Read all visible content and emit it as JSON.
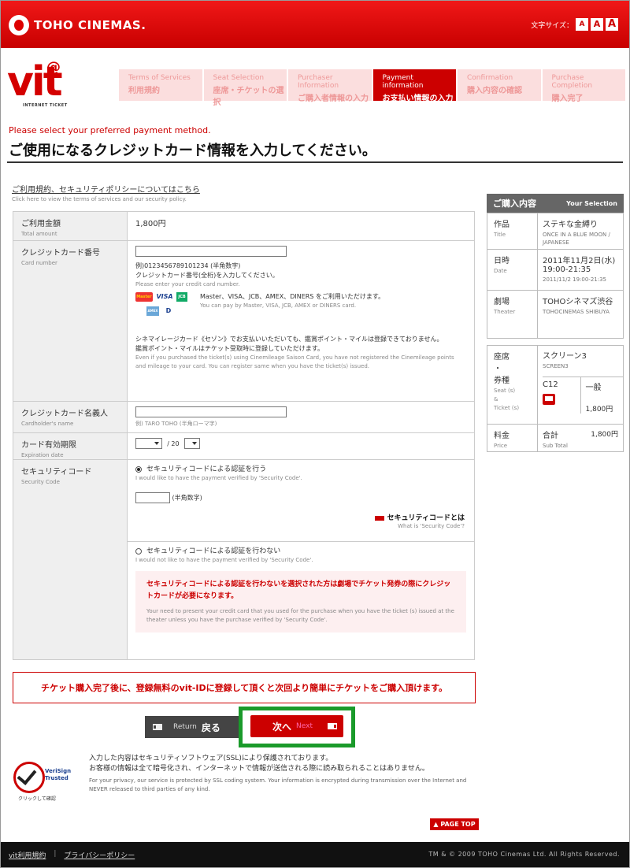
{
  "header": {
    "brand": "TOHO CINEMAS.",
    "font_size_label": "文字サイズ：",
    "font_sizes": [
      "A",
      "A",
      "A"
    ]
  },
  "vit": {
    "logo": "vit",
    "at": "@",
    "sub": "INTERNET TICKET"
  },
  "steps": [
    {
      "en": "Terms of Services",
      "ja": "利用規約"
    },
    {
      "en": "Seat Selection",
      "ja": "座席・チケットの選択"
    },
    {
      "en": "Purchaser Information",
      "ja": "ご購入者情報の入力"
    },
    {
      "en": "Payment information",
      "ja": "お支払い情報の入力"
    },
    {
      "en": "Confirmation",
      "ja": "購入内容の確認"
    },
    {
      "en": "Purchase Completion",
      "ja": "購入完了"
    }
  ],
  "page": {
    "subtitle_en": "Please select your preferred payment method.",
    "title": "ご使用になるクレジットカード情報を入力してください。",
    "policy_link": "ご利用規約、セキュリティポリシーについてはこちら",
    "policy_en": "Click here to view the terms of services and our security policy."
  },
  "form": {
    "amount": {
      "ja": "ご利用金額",
      "en": "Total amount",
      "value": "1,800円"
    },
    "card_number": {
      "ja": "クレジットカード番号",
      "en": "Card number",
      "example": "例)0123456789101234 (半角数字)",
      "hint_ja": "クレジットカード番号(全桁)を入力してください。",
      "hint_en": "Please enter your credit card number.",
      "brands_ja": "Master、VISA、JCB、AMEX、DINERS をご利用いただけます。",
      "brands_en": "You can pay by Master, VISA, JCB, AMEX or DINERS card.",
      "logo_mc": "Master",
      "logo_visa": "VISA",
      "logo_jcb": "JCB",
      "logo_amex": "AMEX",
      "logo_din": "D",
      "saison1": "シネマイレージカード《セゾン》でお支払いいただいても、鑑賞ポイント・マイルは登録できておりません。",
      "saison2": "鑑賞ポイント・マイルはチケット受取時に登録していただけます。",
      "saison_en": "Even if you purchased the ticket(s) using Cinemileage Saison Card, you have not registered the Cinemileage points and mileage to your card. You can register same when you have the ticket(s) issued."
    },
    "holder": {
      "ja": "クレジットカード名義人",
      "en": "Cardholder's name",
      "example": "例) TARO TOHO (半角ローマ字)"
    },
    "expiry": {
      "ja": "カード有効期限",
      "en": "Expiration date",
      "sep": "/ 20"
    },
    "security": {
      "ja": "セキュリティコード",
      "en": "Security Code",
      "opt1_ja": "セキュリティコードによる認証を行う",
      "opt1_en": "I would like to have the payment verified by 'Security Code'.",
      "input_hint": "(半角数字)",
      "what_ja": "セキュリティコードとは",
      "what_en": "What is 'Security Code'?",
      "opt2_ja": "セキュリティコードによる認証を行わない",
      "opt2_en": "I would not like to have the payment verified by 'Security Code'.",
      "warn_ja": "セキュリティコードによる認証を行わないを選択された方は劇場でチケット発券の際にクレジットカードが必要になります。",
      "warn_en": "Your need to present your credit card that you used for the purchase when you have the ticket (s) issued at the theater unless you have the purchase verified by 'Security Code'."
    }
  },
  "panel": {
    "head_ja": "ご購入内容",
    "head_en": "Your Selection",
    "title": {
      "ja": "作品",
      "en": "Title",
      "value": "ステキな金縛り",
      "sub": "ONCE IN A BLUE MOON / JAPANESE"
    },
    "date": {
      "ja": "日時",
      "en": "Date",
      "value": "2011年11月2日(水) 19:00-21:35",
      "sub": "2011/11/2 19:00-21:35"
    },
    "theater": {
      "ja": "劇場",
      "en": "Theater",
      "value": "TOHOシネマズ渋谷",
      "sub": "TOHOCINEMAS SHIBUYA"
    },
    "seat": {
      "ja1": "座席",
      "ja2": "・",
      "ja3": "券種",
      "en1": "Seat (s)",
      "en2": "&",
      "en3": "Ticket (s)",
      "screen": "スクリーン3",
      "screen_en": "SCREEN3",
      "seat_no": "C12",
      "type": "一般",
      "price": "1,800円"
    },
    "total": {
      "ja": "料金",
      "en": "Price",
      "label": "合計",
      "label_en": "Sub Total",
      "value": "1,800円"
    }
  },
  "banner": "チケット購入完了後に、登録無料のvit-IDに登録して頂くと次回より簡単にチケットをご購入頂けます。",
  "buttons": {
    "back_en": "Return",
    "back_ja": "戻る",
    "next_ja": "次へ",
    "next_en": "Next"
  },
  "ssl": {
    "line1": "入力した内容はセキュリティソフトウェア(SSL)により保護されております。",
    "line2": "お客様の情報は全て暗号化され、インターネットで情報が送信される際に読み取られることはありません。",
    "en": "For your privacy, our service is protected by SSL coding system. Your information is encrypted during transmission over the Internet and NEVER released to third parties of any kind.",
    "verisign": "VeriSign Trusted",
    "click": "クリックして確認"
  },
  "pagetop": "▲ PAGE TOP",
  "footer": {
    "link1": "vit利用規約",
    "sep": "|",
    "link2": "プライバシーポリシー",
    "copyright": "TM & © 2009 TOHO Cinemas Ltd. All Rights Reserved."
  },
  "colors": {
    "brand_red": "#cc0000",
    "highlight_green": "#1a9a2a"
  }
}
